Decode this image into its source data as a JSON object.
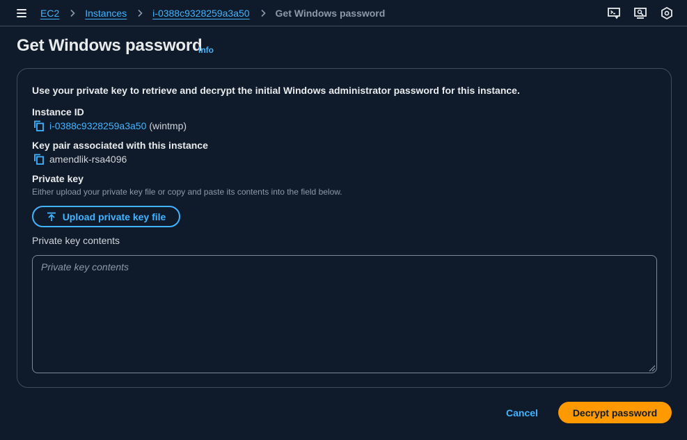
{
  "breadcrumb": {
    "items": [
      {
        "label": "EC2"
      },
      {
        "label": "Instances"
      },
      {
        "label": "i-0388c9328259a3a50"
      }
    ],
    "current": "Get Windows password"
  },
  "top_icons": [
    "cloudshell-icon",
    "screen-share-icon",
    "settings-hexagon-icon"
  ],
  "header": {
    "title": "Get Windows password",
    "info_label": "Info"
  },
  "panel": {
    "intro": "Use your private key to retrieve and decrypt the initial Windows administrator password for this instance.",
    "instance": {
      "label": "Instance ID",
      "id": "i-0388c9328259a3a50",
      "name": "(wintmp)"
    },
    "key_pair": {
      "label": "Key pair associated with this instance",
      "value": "amendlik-rsa4096"
    },
    "private_key": {
      "label": "Private key",
      "description": "Either upload your private key file or copy and paste its contents into the field below.",
      "upload_label": "Upload private key file",
      "contents_label": "Private key contents",
      "contents_placeholder": "Private key contents",
      "contents_value": ""
    }
  },
  "footer": {
    "cancel_label": "Cancel",
    "primary_label": "Decrypt password"
  },
  "colors": {
    "background": "#0f1b2a",
    "link": "#42b4ff",
    "primary": "#ff9900",
    "border": "#414d5c"
  }
}
